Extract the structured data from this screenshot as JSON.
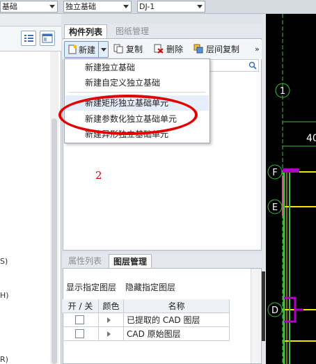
{
  "topbar": {
    "combo1": "基础",
    "combo2": "独立基础",
    "combo3": "DJ-1"
  },
  "left_panel": {
    "fragments": [
      "S)",
      "H)",
      "R)"
    ]
  },
  "middle_panel": {
    "tabs": [
      "构件列表",
      "图纸管理"
    ],
    "toolbar": {
      "new": "新建",
      "copy": "复制",
      "delete": "删除",
      "floor_copy": "层间复制",
      "more": "»"
    },
    "menu": {
      "items": [
        "新建独立基础",
        "新建自定义独立基础",
        "新建矩形独立基础单元",
        "新建参数化独立基础单元",
        "新建异形独立基础单元"
      ]
    },
    "annotation_number": "2"
  },
  "bottom_panel": {
    "tabs": [
      "属性列表",
      "图层管理"
    ],
    "links": [
      "显示指定图层",
      "隐藏指定图层"
    ],
    "columns": [
      "开 / 关",
      "颜色",
      "名称"
    ],
    "rows": [
      {
        "name": "已提取的 CAD 图层"
      },
      {
        "name": "CAD 原始图层"
      }
    ]
  },
  "cad": {
    "axis_labels": [
      "1",
      "F",
      "E",
      "D"
    ],
    "dimension_text": "40",
    "colors": {
      "background": "#000000",
      "axis_line": "#3fbf3f",
      "yellow": "#f2e600",
      "magenta": "#b000c8"
    }
  },
  "accent": {
    "annotation_red": "#e30000"
  }
}
